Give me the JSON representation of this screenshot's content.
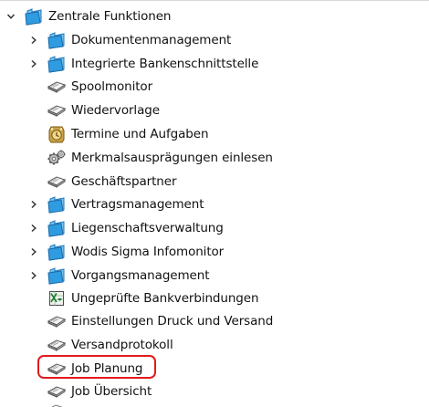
{
  "tree": {
    "root": {
      "label": "Zentrale Funktionen",
      "icon": "folder-icon",
      "expanded": true
    },
    "items": [
      {
        "label": "Dokumentenmanagement",
        "icon": "folder-icon",
        "expandable": true
      },
      {
        "label": "Integrierte Bankenschnittstelle",
        "icon": "folder-icon",
        "expandable": true
      },
      {
        "label": "Spoolmonitor",
        "icon": "book-icon",
        "expandable": false
      },
      {
        "label": "Wiedervorlage",
        "icon": "book-icon",
        "expandable": false
      },
      {
        "label": "Termine und Aufgaben",
        "icon": "alarm-icon",
        "expandable": false
      },
      {
        "label": "Merkmalsausprägungen einlesen",
        "icon": "gears-icon",
        "expandable": false
      },
      {
        "label": "Geschäftspartner",
        "icon": "book-icon",
        "expandable": false
      },
      {
        "label": "Vertragsmanagement",
        "icon": "folder-icon",
        "expandable": true
      },
      {
        "label": "Liegenschaftsverwaltung",
        "icon": "folder-icon",
        "expandable": true
      },
      {
        "label": "Wodis Sigma Infomonitor",
        "icon": "folder-icon",
        "expandable": true
      },
      {
        "label": "Vorgangsmanagement",
        "icon": "folder-icon",
        "expandable": true
      },
      {
        "label": "Ungeprüfte Bankverbindungen",
        "icon": "spreadsheet-icon",
        "expandable": false
      },
      {
        "label": "Einstellungen Druck und Versand",
        "icon": "book-icon",
        "expandable": false
      },
      {
        "label": "Versandprotokoll",
        "icon": "book-icon",
        "expandable": false
      },
      {
        "label": "Job Planung",
        "icon": "book-icon",
        "expandable": false,
        "highlighted": true
      },
      {
        "label": "Job Übersicht",
        "icon": "book-icon",
        "expandable": false
      }
    ]
  },
  "colors": {
    "highlight": "#e3191c",
    "folder": "#2f9be0",
    "text": "#111111"
  }
}
